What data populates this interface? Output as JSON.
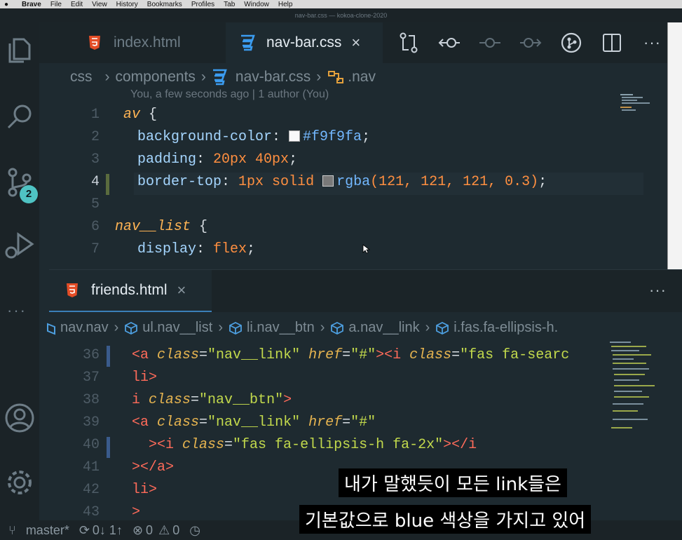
{
  "menubar": {
    "app": "Brave",
    "items": [
      "File",
      "Edit",
      "View",
      "History",
      "Bookmarks",
      "Profiles",
      "Tab",
      "Window",
      "Help"
    ]
  },
  "window_title": "nav-bar.css — kokoa-clone-2020",
  "activity_bar": {
    "scm_badge": "2"
  },
  "editor_top": {
    "tabs": [
      {
        "label": "index.html",
        "icon": "html5-icon",
        "active": false
      },
      {
        "label": "nav-bar.css",
        "icon": "css3-icon",
        "active": true,
        "close": "×"
      }
    ],
    "breadcrumb": [
      "css",
      "components",
      "nav-bar.css",
      ".nav"
    ],
    "blame": "You, a few seconds ago | 1 author (You)",
    "line_numbers": [
      "1",
      "2",
      "3",
      "4",
      "5",
      "6",
      "7"
    ],
    "lines": {
      "l1_selector": "nav",
      "l1_brace": " {",
      "l2_prop": "background-color",
      "l2_colon": ": ",
      "l2_val": "#f9f9fa",
      "l2_end": ";",
      "l3_prop": "padding",
      "l3_colon": ": ",
      "l3_val": "20px 40px",
      "l3_end": ";",
      "l4_prop": "border-top",
      "l4_colon": ": ",
      "l4_val": "1px solid ",
      "l4_fn": "rgba",
      "l4_args": "(121, 121, 121, 0.3)",
      "l4_end": ";",
      "l6_selector": "nav__list",
      "l6_brace": " {",
      "l7_prop": "display",
      "l7_colon": ": ",
      "l7_val": "flex",
      "l7_end": ";"
    },
    "swatch_colors": [
      "#f9f9fa",
      "#797979"
    ]
  },
  "editor_bottom": {
    "tab": {
      "label": "friends.html",
      "close": "×"
    },
    "more": "···",
    "breadcrumb": [
      "nav.nav",
      "ul.nav__list",
      "li.nav__btn",
      "a.nav__link",
      "i.fas.fa-ellipsis-h."
    ],
    "line_numbers": [
      "36",
      "37",
      "38",
      "39",
      "40",
      "41",
      "42",
      "43"
    ],
    "lines": {
      "l36": {
        "a": "<a ",
        "attr1": "class",
        "eq1": "=",
        "s1": "\"nav__link\"",
        "attr2": " href",
        "eq2": "=",
        "s2": "\"#\"",
        "t2": "><i ",
        "attr3": "class",
        "eq3": "=",
        "s3": "\"fas fa-searc"
      },
      "l37": "li>",
      "l38": {
        "t": "i ",
        "attr": "class",
        "eq": "=",
        "s": "\"nav__btn\"",
        "end": ">"
      },
      "l39": {
        "a": "<a ",
        "attr1": "class",
        "eq1": "=",
        "s1": "\"nav__link\"",
        "attr2": " href",
        "eq2": "=",
        "s2": "\"#\""
      },
      "l40": {
        "t1": "  ><i ",
        "attr": "class",
        "eq": "=",
        "s": "\"fas fa-ellipsis-h fa-2x\"",
        "t2": "></i"
      },
      "l41": "></a>",
      "l42": "li>",
      "l43": ">"
    }
  },
  "statusbar": {
    "branch": "master*",
    "sync": "0↓ 1↑",
    "errors": "0",
    "warnings": "0"
  },
  "subtitles": {
    "line1": "내가 말했듯이 모든 link들은",
    "line2": "기본값으로 blue 색상을 가지고 있어"
  }
}
